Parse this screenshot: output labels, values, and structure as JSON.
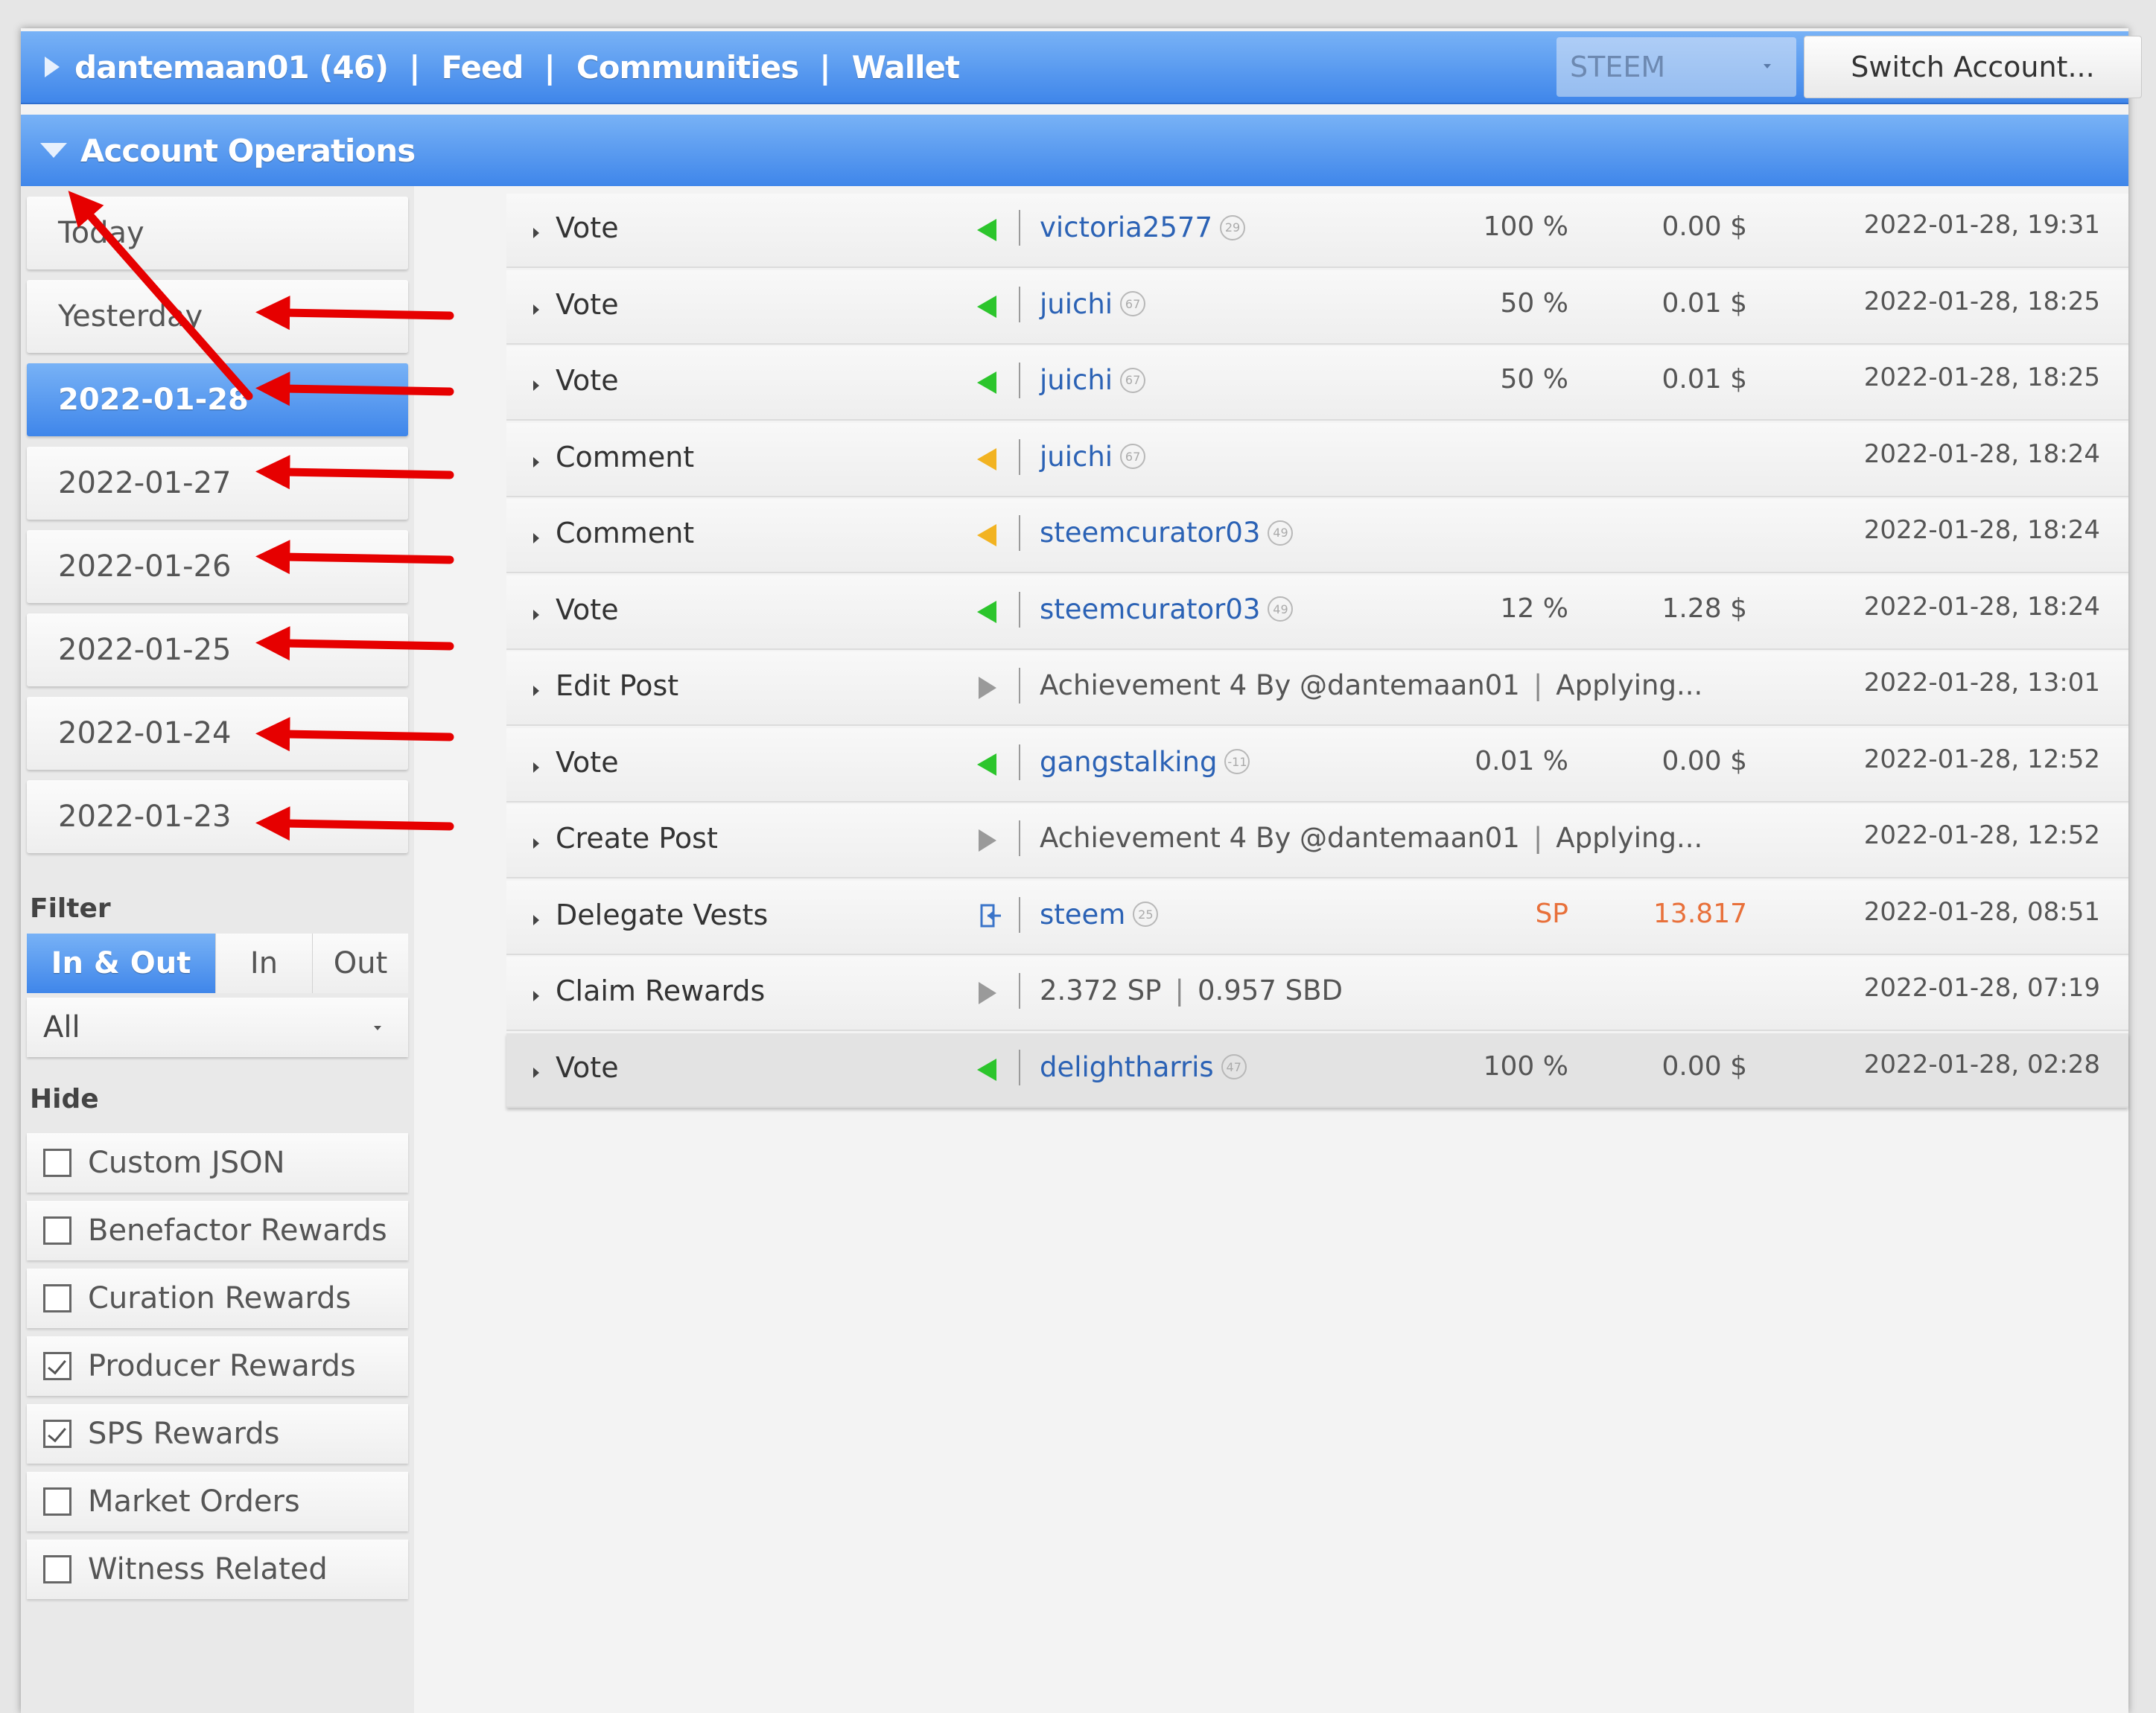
{
  "topbar": {
    "account": "dantemaan01 (46)",
    "links": [
      "Feed",
      "Communities",
      "Wallet"
    ],
    "separator": "|",
    "chain": "STEEM",
    "switch_label": "Switch Account..."
  },
  "section": {
    "title": "Account Operations"
  },
  "sidebar": {
    "days": [
      {
        "label": "Today",
        "active": false
      },
      {
        "label": "Yesterday",
        "active": false
      },
      {
        "label": "2022-01-28",
        "active": true
      },
      {
        "label": "2022-01-27",
        "active": false
      },
      {
        "label": "2022-01-26",
        "active": false
      },
      {
        "label": "2022-01-25",
        "active": false
      },
      {
        "label": "2022-01-24",
        "active": false
      },
      {
        "label": "2022-01-23",
        "active": false
      }
    ],
    "filter_label": "Filter",
    "filter_options": [
      "In & Out",
      "In",
      "Out"
    ],
    "filter_selected": "In & Out",
    "type_select": "All",
    "hide_label": "Hide",
    "hide_items": [
      {
        "label": "Custom JSON",
        "checked": false
      },
      {
        "label": "Benefactor Rewards",
        "checked": false
      },
      {
        "label": "Curation Rewards",
        "checked": false
      },
      {
        "label": "Producer Rewards",
        "checked": true
      },
      {
        "label": "SPS Rewards",
        "checked": true
      },
      {
        "label": "Market Orders",
        "checked": false
      },
      {
        "label": "Witness Related",
        "checked": false
      }
    ]
  },
  "operations": [
    {
      "type": "Vote",
      "dir": "in",
      "user": "victoria2577",
      "rep": "29",
      "pct": "100 %",
      "value": "0.00 $",
      "date": "2022-01-28, 19:31"
    },
    {
      "type": "Vote",
      "dir": "in",
      "user": "juichi",
      "rep": "67",
      "pct": "50 %",
      "value": "0.01 $",
      "date": "2022-01-28, 18:25"
    },
    {
      "type": "Vote",
      "dir": "in",
      "user": "juichi",
      "rep": "67",
      "pct": "50 %",
      "value": "0.01 $",
      "date": "2022-01-28, 18:25"
    },
    {
      "type": "Comment",
      "dir": "out",
      "user": "juichi",
      "rep": "67",
      "pct": "",
      "value": "",
      "date": "2022-01-28, 18:24"
    },
    {
      "type": "Comment",
      "dir": "out",
      "user": "steemcurator03",
      "rep": "49",
      "pct": "",
      "value": "",
      "date": "2022-01-28, 18:24"
    },
    {
      "type": "Vote",
      "dir": "in",
      "user": "steemcurator03",
      "rep": "49",
      "pct": "12 %",
      "value": "1.28 $",
      "date": "2022-01-28, 18:24"
    },
    {
      "type": "Edit Post",
      "dir": "neutral",
      "text": "Achievement 4 By @dantemaan01",
      "text2": "Applying...",
      "date": "2022-01-28, 13:01"
    },
    {
      "type": "Vote",
      "dir": "in",
      "user": "gangstalking",
      "rep": "-11",
      "pct": "0.01 %",
      "value": "0.00 $",
      "date": "2022-01-28, 12:52"
    },
    {
      "type": "Create Post",
      "dir": "neutral",
      "text": "Achievement 4 By @dantemaan01",
      "text2": "Applying...",
      "date": "2022-01-28, 12:52"
    },
    {
      "type": "Delegate Vests",
      "dir": "deleg",
      "user": "steem",
      "rep": "25",
      "pct": "SP",
      "value": "13.817",
      "date": "2022-01-28, 08:51"
    },
    {
      "type": "Claim Rewards",
      "dir": "neutral",
      "text": "2.372 SP",
      "text2": "0.957 SBD",
      "date": "2022-01-28, 07:19"
    },
    {
      "type": "Vote",
      "dir": "in",
      "user": "delightharris",
      "rep": "47",
      "pct": "100 %",
      "value": "0.00 $",
      "date": "2022-01-28, 02:28"
    }
  ],
  "colors": {
    "accent": "#4a90ee",
    "incoming": "#2cc52c",
    "outgoing": "#f2b321",
    "annotation": "#e60000",
    "sp_value": "#e8703a"
  }
}
